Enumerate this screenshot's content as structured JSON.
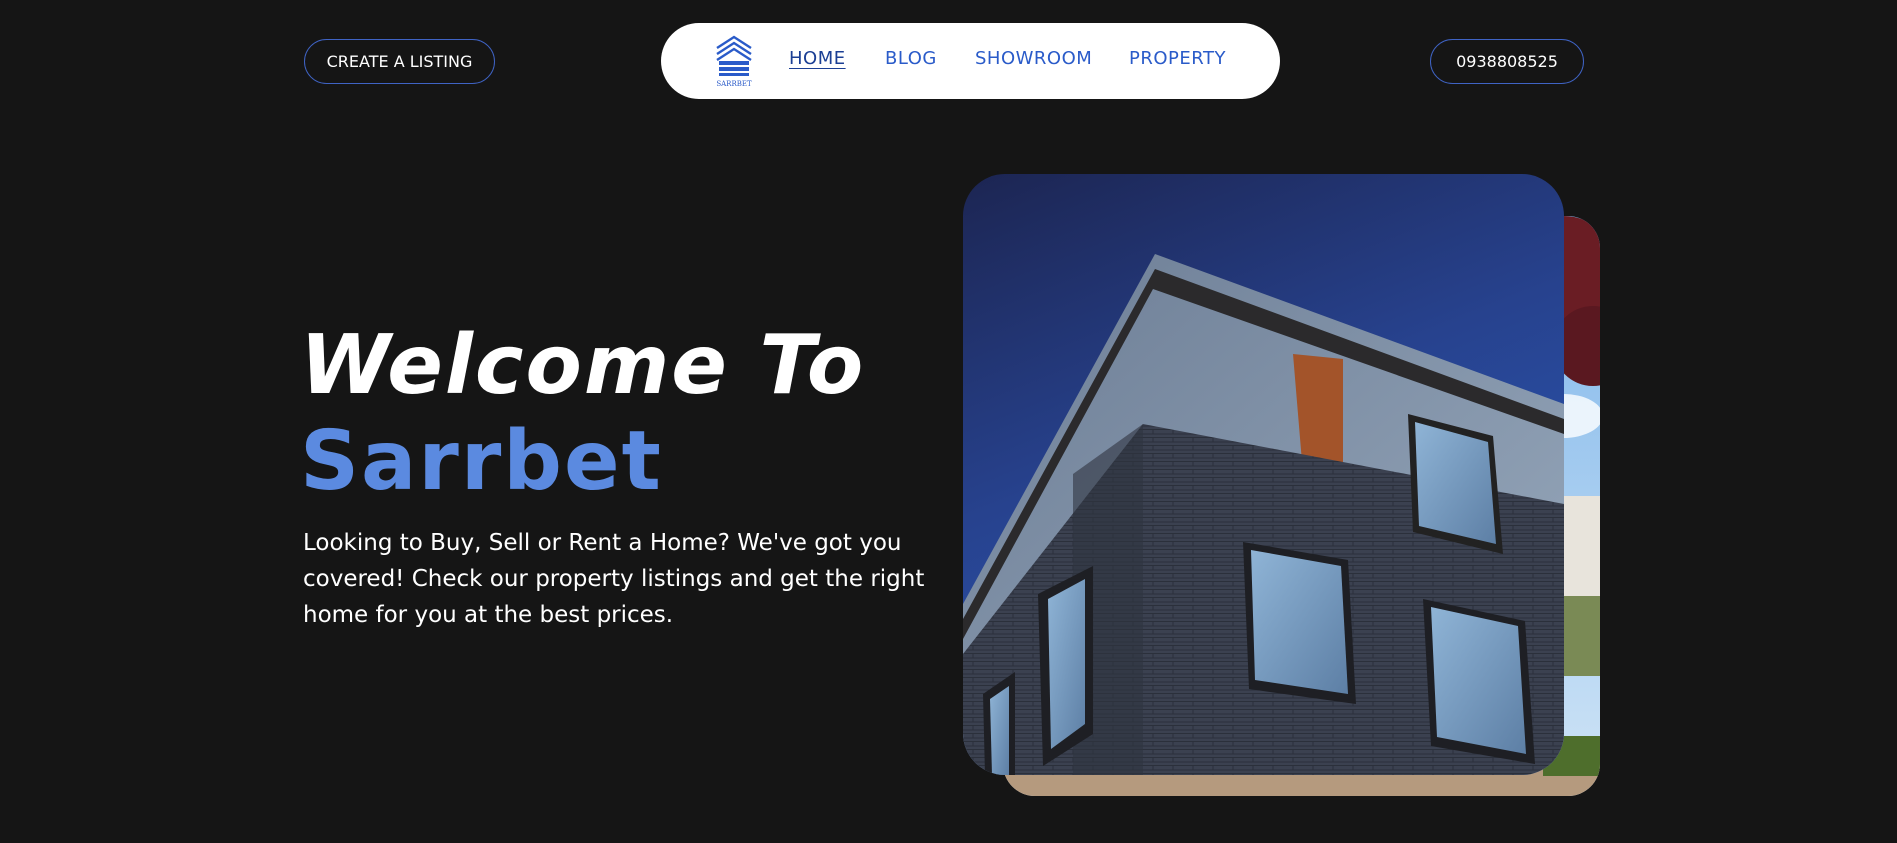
{
  "header": {
    "create_listing_label": "CREATE A LISTING",
    "phone_label": "0938808525",
    "logo_text": "SARRBET",
    "nav": [
      {
        "label": "HOME",
        "active": true
      },
      {
        "label": "BLOG",
        "active": false
      },
      {
        "label": "SHOWROOM",
        "active": false
      },
      {
        "label": "PROPERTY",
        "active": false
      }
    ]
  },
  "hero": {
    "title_line1": "Welcome To",
    "title_brand": "Sarrbet",
    "description": "Looking to Buy, Sell or Rent a Home? We've got you covered! Check our property listings and get the right home for you at the best prices."
  },
  "colors": {
    "background": "#151515",
    "accent": "#5b8ae0",
    "nav_link": "#2a5bc9",
    "button_border": "#3f63c4"
  },
  "icons": {
    "logo": "building-logo-icon"
  }
}
